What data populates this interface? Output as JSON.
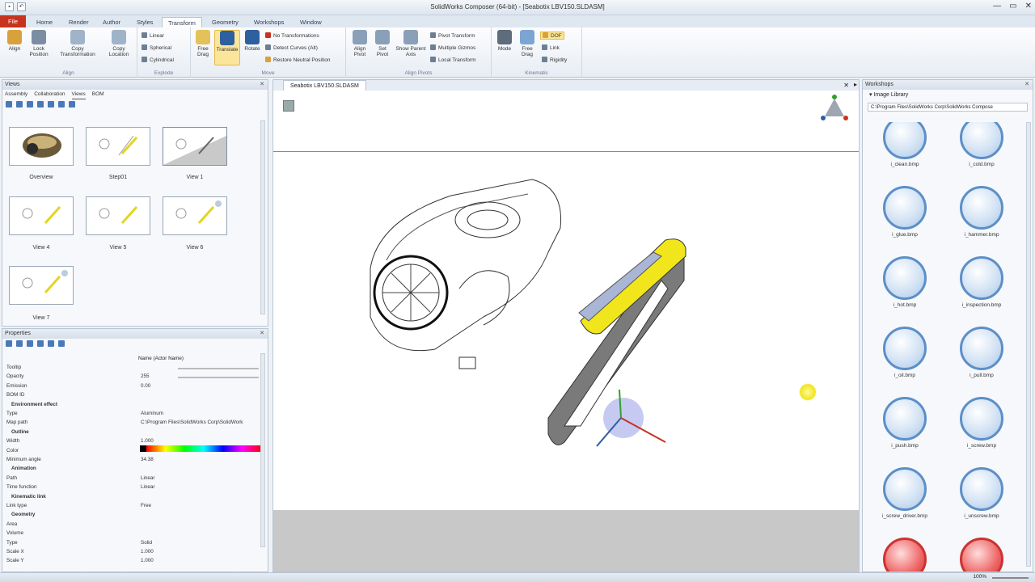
{
  "window": {
    "title": "SolidWorks Composer (64-bit) - [Seabotix LBV150.SLDASM]",
    "min": "—",
    "max": "▭",
    "close": "✕"
  },
  "tabs": [
    "File",
    "Home",
    "Render",
    "Author",
    "Styles",
    "Transform",
    "Geometry",
    "Workshops",
    "Window"
  ],
  "ribbon": {
    "align_group": {
      "label": "Align",
      "buttons": [
        "Align",
        "Lock Position",
        "Copy Transformation",
        "Copy Location"
      ]
    },
    "explode_group": {
      "label": "Explode",
      "items": [
        "Linear",
        "Spherical",
        "Cylindrical"
      ]
    },
    "move_group": {
      "label": "Move",
      "buttons": [
        "Free Drag",
        "Translate",
        "Rotate"
      ],
      "items": [
        "No Transformations",
        "Detect Curves (Alt)",
        "Restore Neutral Position"
      ]
    },
    "align_pivots_group": {
      "label": "Align Pivots",
      "buttons": [
        "Align Pivot",
        "Set Pivot",
        "Show Parent Axis"
      ],
      "items": [
        "Pivot Transform",
        "Multiple Gizmos",
        "Local Transform"
      ]
    },
    "kinematic_group": {
      "label": "Kinematic",
      "buttons": [
        "Mode",
        "Free Drag"
      ],
      "items": [
        "DOF",
        "Link",
        "Rigidity"
      ]
    }
  },
  "views_panel": {
    "title": "Views",
    "tabs": [
      "Assembly",
      "Collaboration",
      "Views",
      "BOM"
    ],
    "thumbnails": [
      "Overview",
      "Step01",
      "View 1",
      "View 4",
      "View 5",
      "View 6",
      "View 7"
    ]
  },
  "properties_panel": {
    "title": "Properties",
    "header_value": "Name (Actor Name)",
    "rows": [
      {
        "k": "Tooltip",
        "v": ""
      },
      {
        "k": "Opacity",
        "v": "255"
      },
      {
        "k": "Emission",
        "v": "0.00"
      },
      {
        "k": "BOM ID",
        "v": ""
      },
      {
        "k": "Environment effect",
        "v": "",
        "sec": true
      },
      {
        "k": "Type",
        "v": "Aluminum"
      },
      {
        "k": "Map path",
        "v": "C:\\Program Files\\SolidWorks Corp\\SolidWork"
      },
      {
        "k": "Outline",
        "v": "",
        "sec": true
      },
      {
        "k": "Width",
        "v": "1.000"
      },
      {
        "k": "Color",
        "v": ""
      },
      {
        "k": "Minimum angle",
        "v": "34.38"
      },
      {
        "k": "Animation",
        "v": "",
        "sec": true
      },
      {
        "k": "Path",
        "v": "Linear"
      },
      {
        "k": "Time function",
        "v": "Linear"
      },
      {
        "k": "Kinematic link",
        "v": "",
        "sec": true
      },
      {
        "k": "Link type",
        "v": "Free"
      },
      {
        "k": "Geometry",
        "v": "",
        "sec": true
      },
      {
        "k": "Area",
        "v": ""
      },
      {
        "k": "Volume",
        "v": ""
      },
      {
        "k": "Type",
        "v": "Solid"
      },
      {
        "k": "Scale X",
        "v": "1.000"
      },
      {
        "k": "Scale Y",
        "v": "1.000"
      }
    ]
  },
  "document": {
    "tab": "Seabotix LBV150.SLDASM"
  },
  "workshops_panel": {
    "title": "Workshops",
    "sub": "Image Library",
    "path": "C:\\Program Files\\SolidWorks Corp\\SolidWorks Compose",
    "items": [
      "i_clean.bmp",
      "i_cold.bmp",
      "i_glue.bmp",
      "i_hammer.bmp",
      "i_hot.bmp",
      "i_inspection.bmp",
      "i_oil.bmp",
      "i_pull.bmp",
      "i_push.bmp",
      "i_screw.bmp",
      "i_screw_driver.bmp",
      "i_unscrew.bmp",
      "",
      ""
    ]
  },
  "status": {
    "zoom": "100%"
  },
  "colors": {
    "selection": "#f1e61c",
    "file_tab": "#c8331d",
    "accent": "#4a79b8"
  }
}
